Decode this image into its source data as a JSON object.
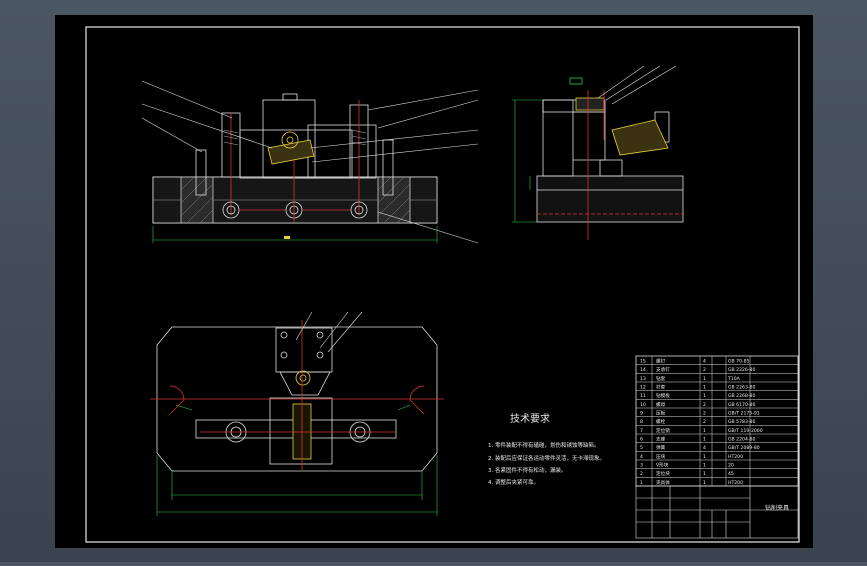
{
  "drawing": {
    "tech_title": "技术要求",
    "tech_lines": [
      "1. 零件装配不得有磕碰，划伤和锈蚀等缺陷。",
      "2. 装配后应保证各运动零件灵活，无卡滞现象。",
      "3. 各紧固件不得有松动，漏装。",
      "4. 调整后夹紧可靠。"
    ],
    "title_block_name": "钻削夹具",
    "bom_rows": [
      {
        "no": "15",
        "name": "螺钉",
        "qty": "4",
        "spec": "GB 70-85"
      },
      {
        "no": "14",
        "name": "支承钉",
        "qty": "2",
        "spec": "GB 2226-80"
      },
      {
        "no": "13",
        "name": "钻套",
        "qty": "1",
        "spec": "T10A"
      },
      {
        "no": "12",
        "name": "衬套",
        "qty": "1",
        "spec": "GB 2263-80"
      },
      {
        "no": "11",
        "name": "钻模板",
        "qty": "1",
        "spec": "GB 2268-80"
      },
      {
        "no": "10",
        "name": "螺母",
        "qty": "2",
        "spec": "GB 6170-86"
      },
      {
        "no": "9",
        "name": "压板",
        "qty": "2",
        "spec": "GB/T 2175-91"
      },
      {
        "no": "8",
        "name": "螺栓",
        "qty": "2",
        "spec": "GB 5783-86"
      },
      {
        "no": "7",
        "name": "定位销",
        "qty": "1",
        "spec": "GB/T 119-2000"
      },
      {
        "no": "6",
        "name": "支座",
        "qty": "1",
        "spec": "GB 2204-80"
      },
      {
        "no": "5",
        "name": "弹簧",
        "qty": "4",
        "spec": "GB/T 2089-80"
      },
      {
        "no": "4",
        "name": "压块",
        "qty": "1",
        "spec": "HT200"
      },
      {
        "no": "3",
        "name": "V形块",
        "qty": "1",
        "spec": "20"
      },
      {
        "no": "2",
        "name": "定位块",
        "qty": "1",
        "spec": "45"
      },
      {
        "no": "1",
        "name": "夹具体",
        "qty": "1",
        "spec": "HT200"
      }
    ]
  }
}
